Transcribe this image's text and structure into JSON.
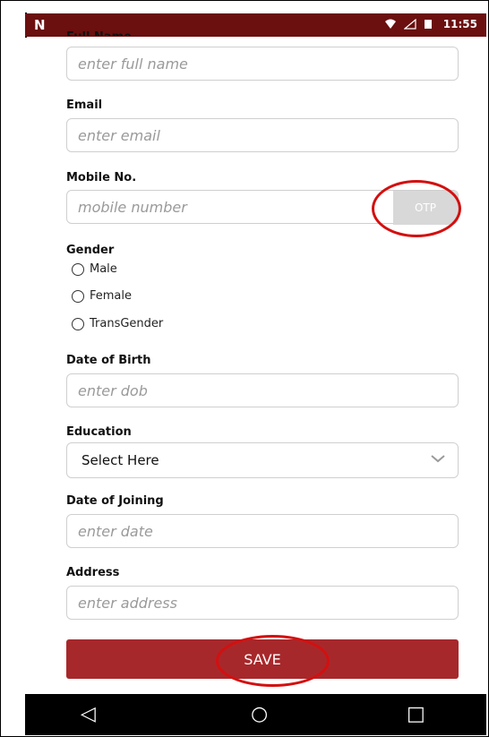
{
  "status_bar": {
    "left_icon": "N",
    "time": "11:55",
    "wifi_icon": "wifi-icon",
    "signal_icon": "signal-icon",
    "battery_icon": "battery-icon"
  },
  "form": {
    "full_name": {
      "label": "Full Name",
      "placeholder": "enter full name"
    },
    "email": {
      "label": "Email",
      "placeholder": "enter email"
    },
    "mobile": {
      "label": "Mobile No.",
      "placeholder": "mobile number",
      "otp_label": "OTP"
    },
    "gender": {
      "label": "Gender",
      "options": [
        "Male",
        "Female",
        "TransGender"
      ]
    },
    "dob": {
      "label": "Date of Birth",
      "placeholder": "enter dob"
    },
    "education": {
      "label": "Education",
      "value": "Select Here"
    },
    "doj": {
      "label": "Date of Joining",
      "placeholder": "enter date"
    },
    "address": {
      "label": "Address",
      "placeholder": "enter address"
    },
    "save_label": "SAVE"
  },
  "navbar": {
    "back_icon": "◁",
    "home_icon": "○",
    "recents_icon": "□"
  },
  "colors": {
    "status_bar": "#6b0f0f",
    "save_button": "#a7282b",
    "highlight_ring": "#d40f0f"
  }
}
